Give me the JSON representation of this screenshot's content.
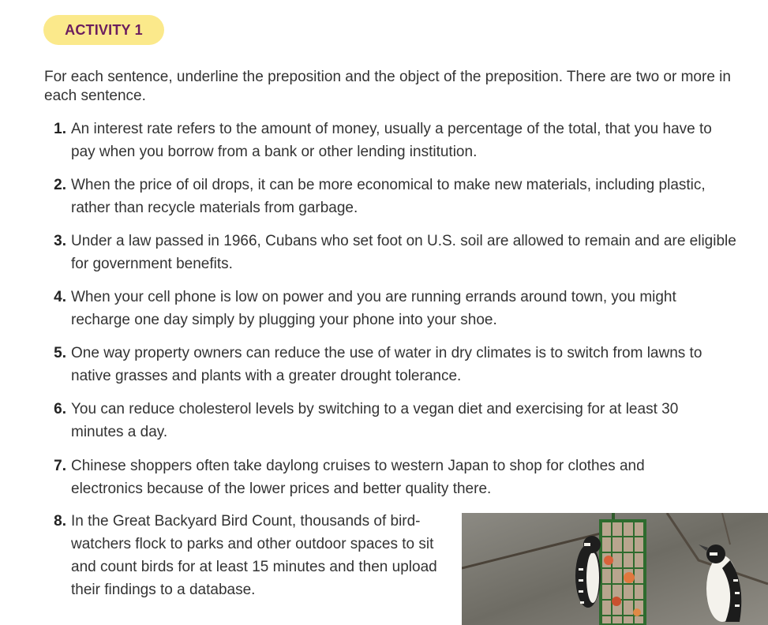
{
  "activity": {
    "label": "ACTIVITY 1"
  },
  "instructions": "For each sentence, underline the preposition and the object of the preposition. There are two or more in each sentence.",
  "items": [
    {
      "number": "1.",
      "text": "An interest rate refers to the amount of money, usually a percentage of the total, that you have to pay when you borrow from a bank or other lending institution."
    },
    {
      "number": "2.",
      "text": "When the price of oil drops, it can be more economical to make new materials, including plastic, rather than recycle materials from garbage."
    },
    {
      "number": "3.",
      "text": "Under a law passed in 1966, Cubans who set foot on U.S. soil are allowed to remain and are eligible for government benefits."
    },
    {
      "number": "4.",
      "text": "When your cell phone is low on power and you are running errands around town, you might recharge one day simply by plugging your phone into your shoe."
    },
    {
      "number": "5.",
      "text": "One way property owners can reduce the use of water in dry climates is to switch from lawns to native grasses and plants with a greater drought tolerance."
    },
    {
      "number": "6.",
      "text": "You can reduce cholesterol levels by switching to a vegan diet and exercising for at least 30 minutes a day."
    },
    {
      "number": "7.",
      "text": "Chinese shoppers often take daylong cruises to western Japan to shop for clothes and electronics because of the lower prices and better quality there."
    },
    {
      "number": "8.",
      "text": "In the Great Backyard Bird Count, thousands of bird-watchers flock to parks and other outdoor spaces to sit and count birds for at least 15 minutes and then upload their findings to a database."
    }
  ],
  "colors": {
    "badge_background": "#fbe98b",
    "badge_text": "#6b1d5e",
    "body_text": "#333333"
  }
}
